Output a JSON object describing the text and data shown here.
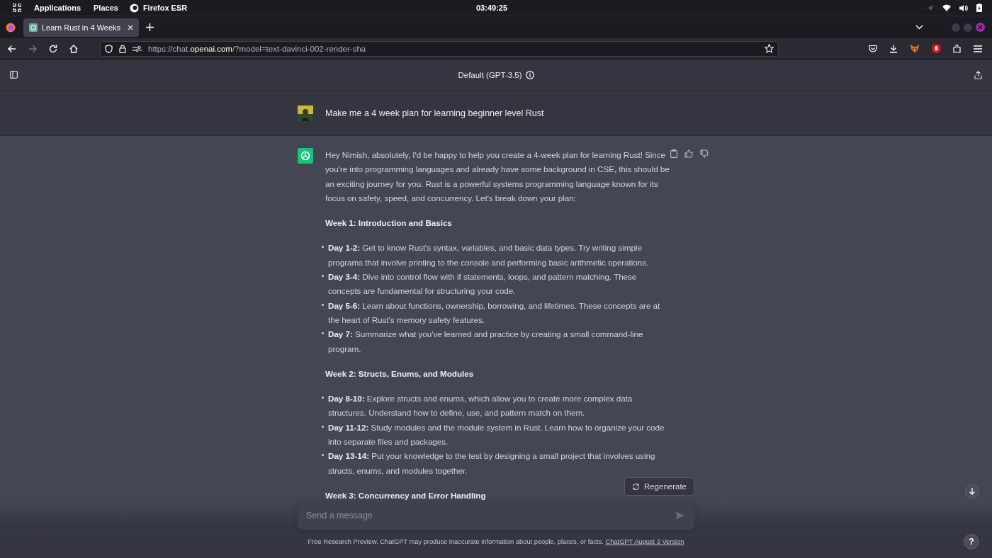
{
  "system_bar": {
    "menus": [
      "Applications",
      "Places",
      "Firefox ESR"
    ],
    "clock": "03:49:25"
  },
  "browser": {
    "tab": {
      "title": "Learn Rust in 4 Weeks",
      "selected": true
    },
    "url": [
      {
        "kind": "dim",
        "text": "https://chat."
      },
      {
        "kind": "host",
        "text": "openai.com"
      },
      {
        "kind": "dim",
        "text": "/?model=text-davinci-002-render-sha"
      }
    ]
  },
  "chat": {
    "model": "Default (GPT-3.5)",
    "user_message": "Make me a 4 week plan for learning beginner level Rust",
    "reply": [
      {
        "kind": "para",
        "text": "Hey Nimish, absolutely, I'd be happy to help you create a 4-week plan for learning Rust! Since you're into programming languages and already have some background in CSE, this should be an exciting journey for you. Rust is a powerful systems programming language known for its focus on safety, speed, and concurrency. Let's break down your plan:"
      },
      {
        "kind": "heading",
        "text": "Week 1: Introduction and Basics"
      },
      {
        "kind": "list",
        "items": [
          "**Day 1-2:** Get to know Rust's syntax, variables, and basic data types. Try writing simple programs that involve printing to the console and performing basic arithmetic operations.",
          "**Day 3-4:** Dive into control flow with if statements, loops, and pattern matching. These concepts are fundamental for structuring your code.",
          "**Day 5-6:** Learn about functions, ownership, borrowing, and lifetimes. These concepts are at the heart of Rust's memory safety features.",
          "**Day 7:** Summarize what you've learned and practice by creating a small command-line program."
        ]
      },
      {
        "kind": "heading",
        "text": "Week 2: Structs, Enums, and Modules"
      },
      {
        "kind": "list",
        "items": [
          "**Day 8-10:** Explore structs and enums, which allow you to create more complex data structures. Understand how to define, use, and pattern match on them.",
          "**Day 11-12:** Study modules and the module system in Rust. Learn how to organize your code into separate files and packages.",
          "**Day 13-14:** Put your knowledge to the test by designing a small project that involves using structs, enums, and modules together."
        ]
      },
      {
        "kind": "heading",
        "text": "Week 3: Concurrency and Error Handling"
      }
    ],
    "regenerate": "Regenerate",
    "input": {
      "placeholder": "Send a message"
    },
    "disclaimer": "Free Research Preview. ChatGPT may produce inaccurate information about people, places, or facts.",
    "version_link": "ChatGPT August 3 Version",
    "help": "?"
  }
}
